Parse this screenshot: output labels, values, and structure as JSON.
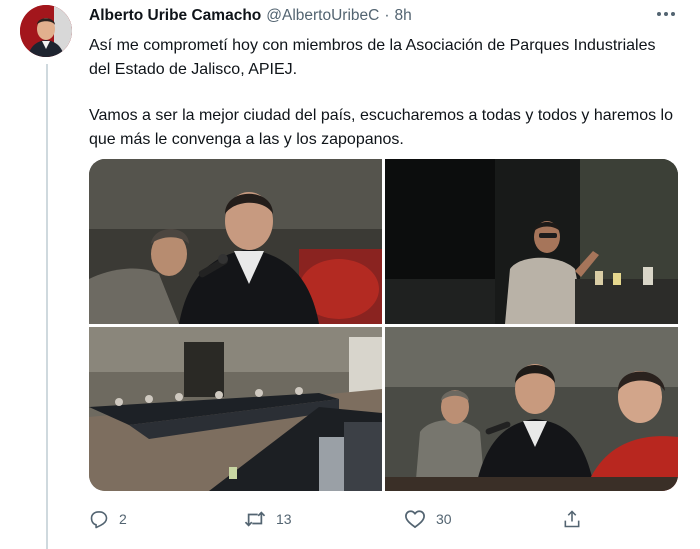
{
  "tweet": {
    "author_name": "Alberto Uribe Camacho",
    "handle": "@AlbertoUribeC",
    "separator": "·",
    "time": "8h",
    "paragraphs": [
      "Así me comprometí hoy con miembros de la Asociación de Parques Industriales del Estado de Jalisco, APIEJ.",
      "Vamos a ser la mejor ciudad del país, escucharemos a todas y todos y haremos lo que más le convenga a las y los zapopanos."
    ],
    "photos": [
      "photo-speaker-closeup",
      "photo-speaker-standing",
      "photo-meeting-room",
      "photo-speaker-table"
    ]
  },
  "actions": {
    "reply_count": "2",
    "retweet_count": "13",
    "like_count": "30"
  },
  "icons": {
    "more": "more-horizontal-icon",
    "reply": "reply-icon",
    "retweet": "retweet-icon",
    "like": "heart-icon",
    "share": "share-icon"
  },
  "colors": {
    "text": "#0f1419",
    "secondary": "#536471",
    "thread_line": "#cfd9de",
    "avatar_bg": "#9e1e22"
  }
}
